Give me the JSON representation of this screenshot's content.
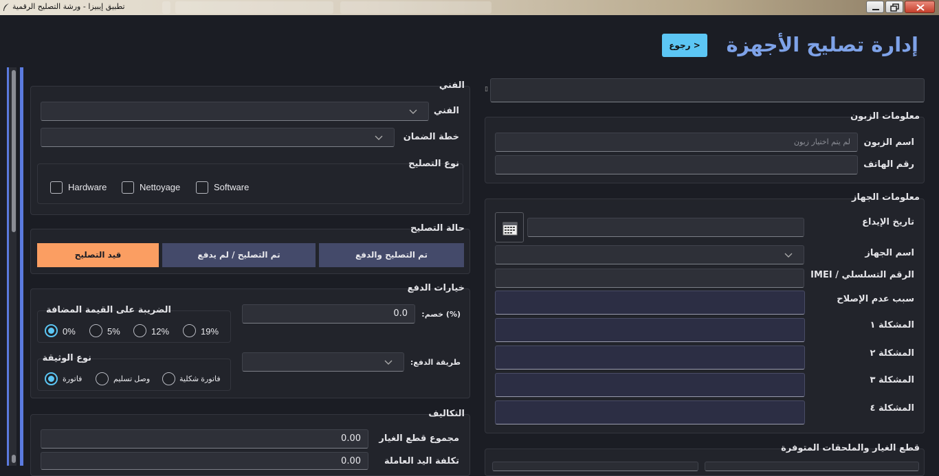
{
  "window": {
    "title": "تطبيق إيبيزا - ورشة التصليح الرقمية",
    "icon": "feather-icon"
  },
  "header": {
    "title": "إدارة تصليح الأجهزة",
    "back_label": "< رجوع"
  },
  "customer": {
    "section_title": "معلومات الزبون",
    "name_label": "اسم الزبون",
    "name_placeholder": "لم يتم اختيار زبون",
    "phone_label": "رقم الهاتف",
    "phone_value": ""
  },
  "device": {
    "section_title": "معلومات الجهاز",
    "date_label": "تاريخ الإيداع",
    "name_label": "اسم الجهاز",
    "serial_label": "الرقم التسلسلي / IMEI",
    "reason_label": "سبب عدم الإصلاح",
    "problem1_label": "المشكلة ١",
    "problem2_label": "المشكلة ٢",
    "problem3_label": "المشكلة ٣",
    "problem4_label": "المشكلة ٤"
  },
  "parts": {
    "section_title": "قطع الغيار والملحقات المتوفرة"
  },
  "technician": {
    "section_title": "الفني",
    "tech_label": "الفني",
    "warranty_label": "خطة الضمان"
  },
  "repair_type": {
    "section_title": "نوع التصليح",
    "options": [
      "Software",
      "Nettoyage",
      "Hardware"
    ]
  },
  "repair_status": {
    "section_title": "حالة التصليح",
    "buttons": [
      "تم التصليح والدفع",
      "تم التصليح / لم يدفع",
      "قيد التصليح"
    ],
    "active_index": 2,
    "active_color": "#fb9e62"
  },
  "payment": {
    "section_title": "خيارات الدفع",
    "discount_label": "(%) خصم:",
    "discount_value": "0.0",
    "method_label": "طريقة الدفع:",
    "tax_title": "الضريبة على القيمة المضافة",
    "tax_options": [
      "19%",
      "12%",
      "5%",
      "0%"
    ],
    "tax_selected": "0%",
    "doc_title": "نوع الوثيقة",
    "doc_options": [
      "فاتورة شكلية",
      "وصل تسليم",
      "فاتورة"
    ],
    "doc_selected": "فاتورة"
  },
  "costs": {
    "section_title": "التكاليف",
    "parts_total_label": "مجموع قطع الغيار",
    "parts_total_value": "0.00",
    "labor_label": "تكلفة اليد العاملة",
    "labor_value": "0.00"
  },
  "colors": {
    "accent": "#5cc6f4",
    "title": "#7ea2e8",
    "button_idle": "#444a6a"
  }
}
